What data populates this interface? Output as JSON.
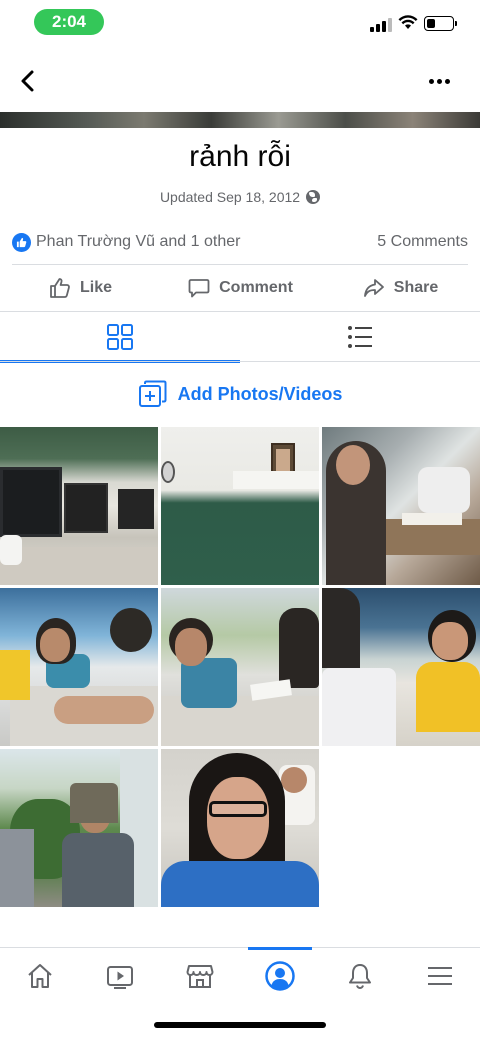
{
  "status_bar": {
    "time": "2:04"
  },
  "album": {
    "title": "rảnh rỗi",
    "updated": "Updated Sep 18, 2012"
  },
  "reactions": {
    "liked_by": "Phan Trường Vũ and 1 other",
    "comments": "5 Comments"
  },
  "actions": {
    "like": "Like",
    "comment": "Comment",
    "share": "Share"
  },
  "add_photos_label": "Add Photos/Videos",
  "icons": {
    "back": "chevron-left-icon",
    "more": "more-dots-icon",
    "privacy": "globe-icon",
    "grid_view": "grid-icon",
    "list_view": "list-icon"
  },
  "bottom_nav": [
    "home-icon",
    "watch-icon",
    "marketplace-icon",
    "profile-icon",
    "notifications-icon",
    "menu-icon"
  ],
  "colors": {
    "accent": "#1877f2",
    "status_pill": "#34c759"
  }
}
